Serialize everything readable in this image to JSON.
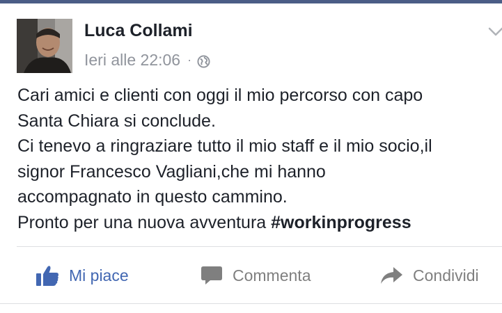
{
  "post": {
    "author_name": "Luca Collami",
    "timestamp": "Ieri alle 22:06",
    "separator": "·",
    "audience_icon": "globe-icon",
    "options_icon": "chevron-down-icon",
    "text_lines": [
      "Cari amici e clienti con oggi il mio percorso con capo",
      "Santa Chiara si conclude.",
      "Ci tenevo a ringraziare tutto il mio staff e il mio socio,il",
      "signor Francesco Vagliani,che mi hanno",
      "accompagnato in questo cammino."
    ],
    "last_line_text": "Pronto per una nuova avventura ",
    "hashtag": "#workinprogress"
  },
  "actions": {
    "like_label": "Mi piace",
    "comment_label": "Commenta",
    "share_label": "Condividi"
  },
  "colors": {
    "accent": "#4267b2",
    "text": "#1d2129",
    "meta": "#90949c",
    "action_gray": "#7f7f7f",
    "top_bar": "#4b5d86"
  }
}
